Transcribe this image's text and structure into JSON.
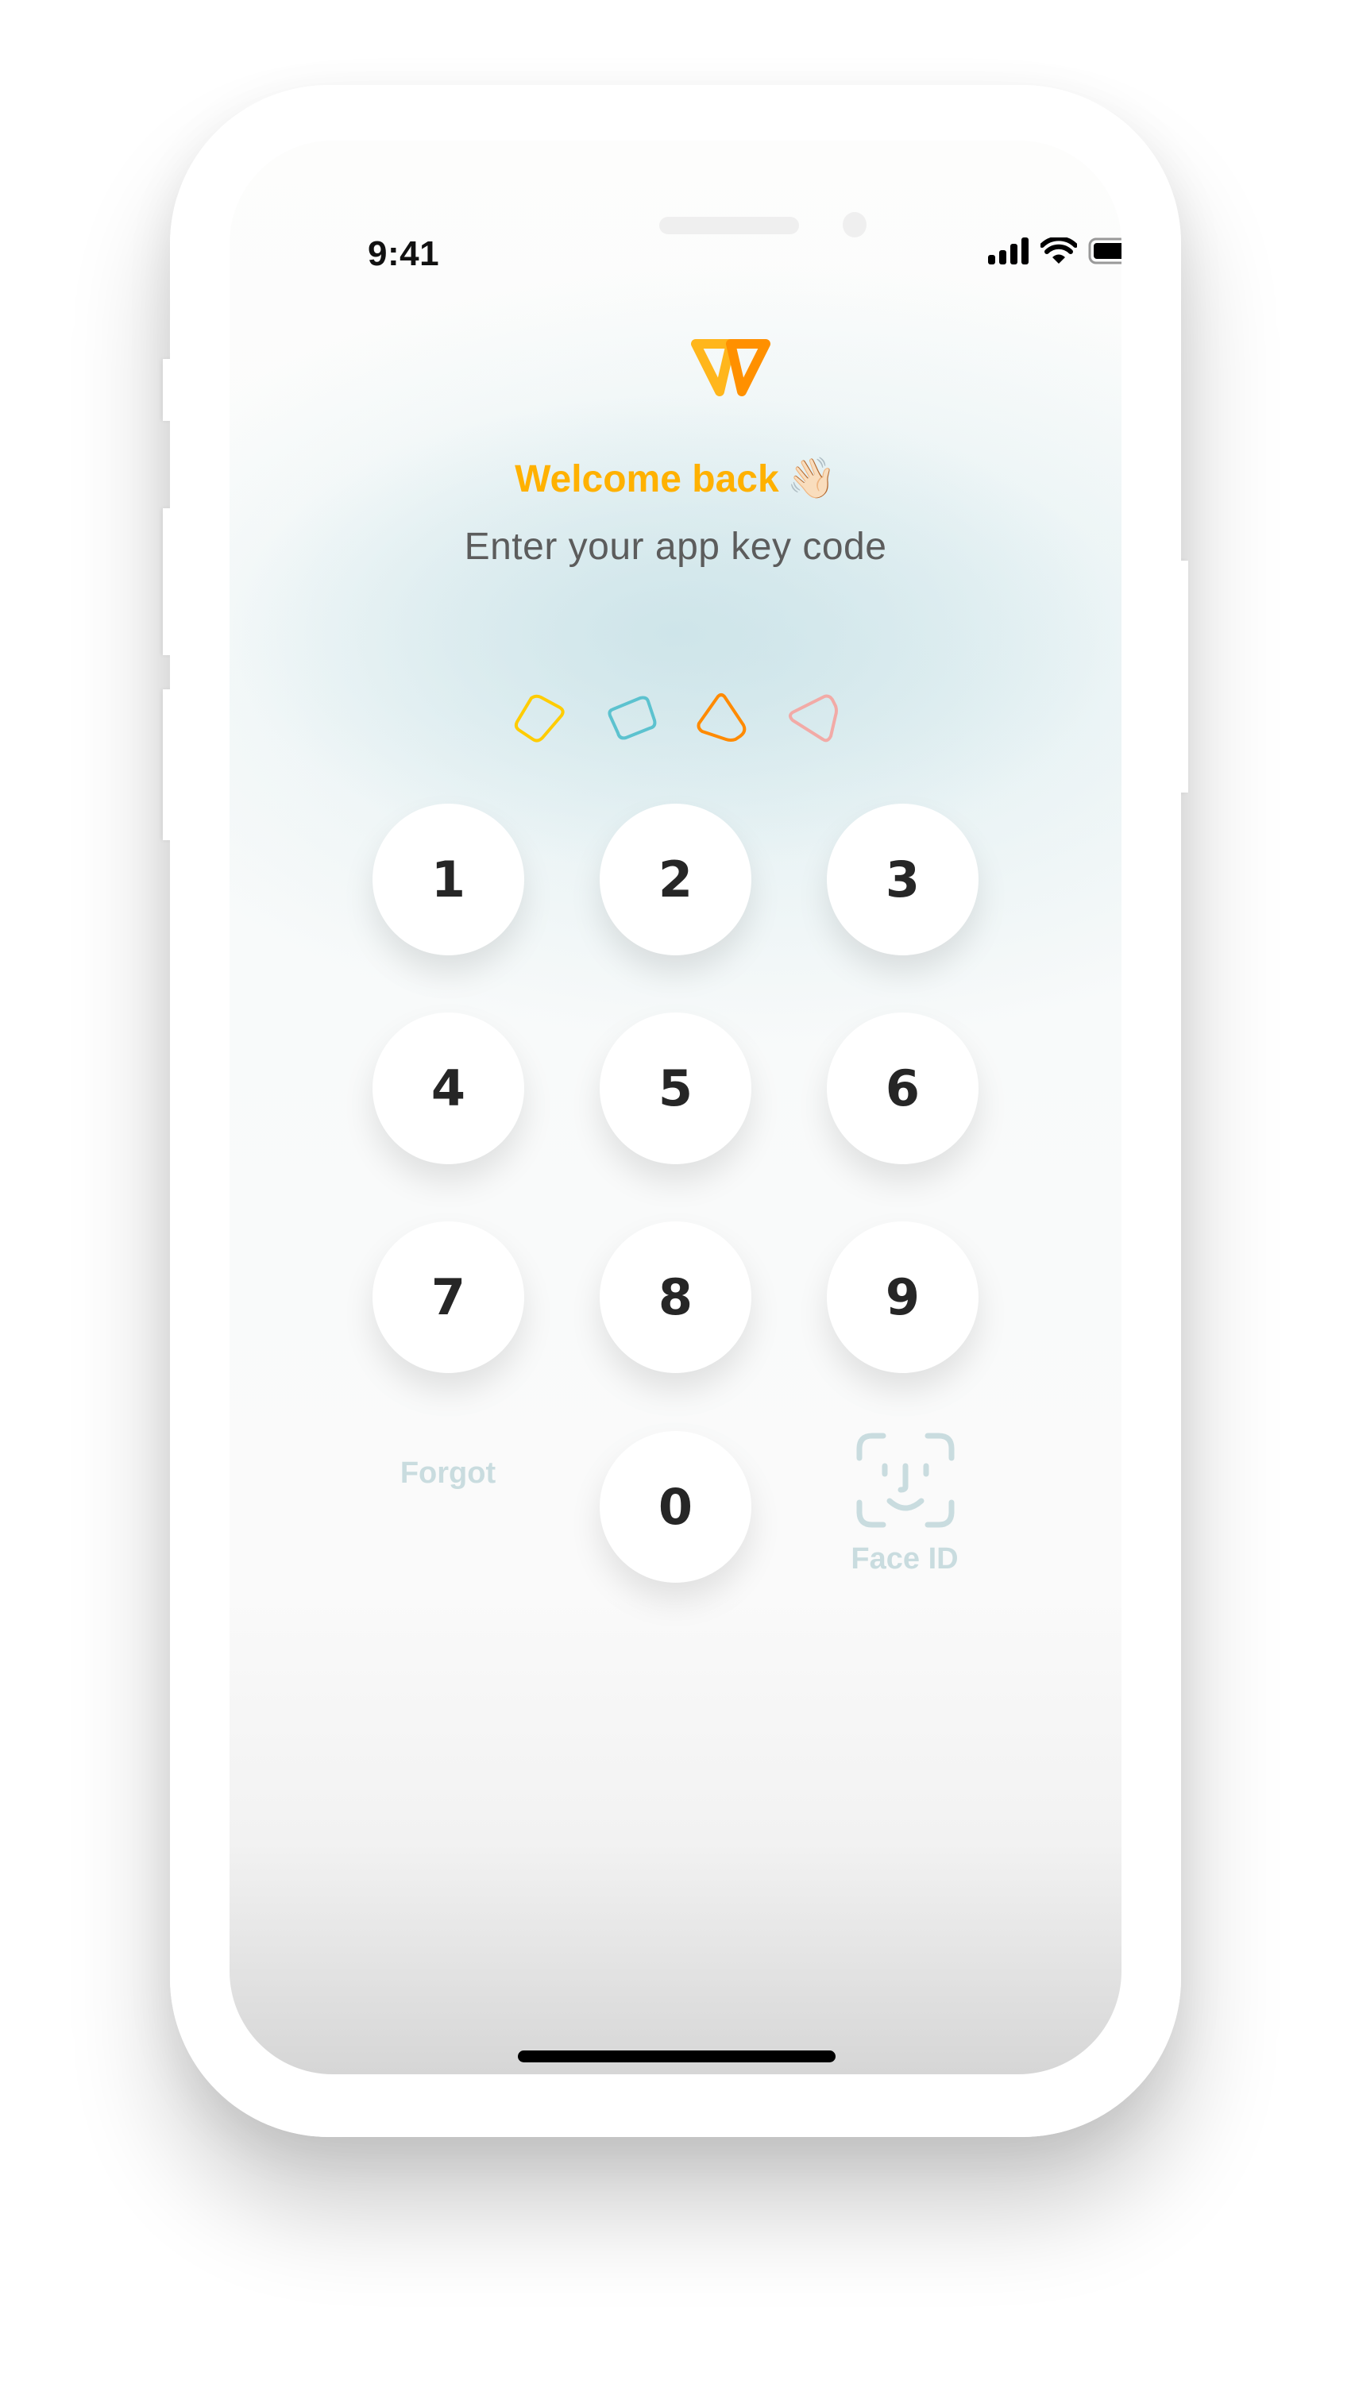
{
  "status_bar": {
    "time": "9:41",
    "icons": [
      "cellular-signal-icon",
      "wifi-icon",
      "battery-icon"
    ]
  },
  "app": {
    "logo": "w-logo-icon",
    "brand_colors": {
      "primary": "#ffb100",
      "secondary": "#ff8c00"
    },
    "welcome_text": "Welcome back",
    "welcome_emoji": "👋🏻",
    "subtitle": "Enter your app key code"
  },
  "code_indicator": {
    "length": 4,
    "entered": 0,
    "shapes": [
      {
        "name": "code-dot-1",
        "color": "#ffcc00"
      },
      {
        "name": "code-dot-2",
        "color": "#5cc2cf"
      },
      {
        "name": "code-dot-3",
        "color": "#ff8a00"
      },
      {
        "name": "code-dot-4",
        "color": "#f2aaa6"
      }
    ]
  },
  "keypad": {
    "keys": [
      "1",
      "2",
      "3",
      "4",
      "5",
      "6",
      "7",
      "8",
      "9",
      "0"
    ],
    "forgot_label": "Forgot",
    "faceid_label": "Face ID"
  }
}
